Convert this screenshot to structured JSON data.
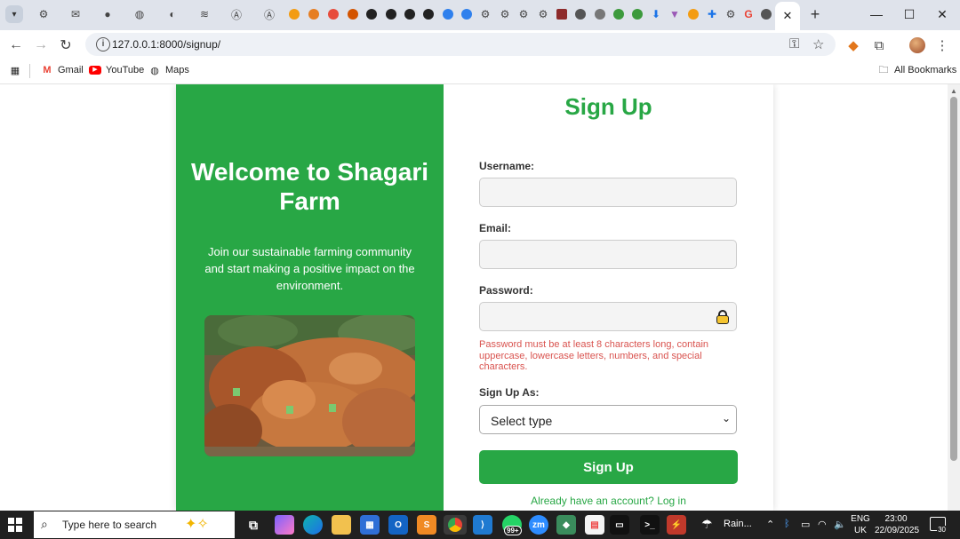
{
  "browser": {
    "url": "127.0.0.1:8000/signup/",
    "bookmarks": [
      {
        "label": "Gmail",
        "icon": "gmail-icon"
      },
      {
        "label": "YouTube",
        "icon": "youtube-icon"
      },
      {
        "label": "Maps",
        "icon": "maps-icon"
      }
    ],
    "all_bookmarks": "All Bookmarks"
  },
  "page": {
    "welcome_title": "Welcome to Shagari Farm",
    "intro_text": "Join our sustainable farming community and start making a positive impact on the environment.",
    "form_title": "Sign Up",
    "username_label": "Username:",
    "email_label": "Email:",
    "password_label": "Password:",
    "password_error": "Password must be at least 8 characters long, contain uppercase, lowercase letters, numbers, and special characters.",
    "signup_as_label": "Sign Up As:",
    "signup_as_selected": "Select type",
    "submit_label": "Sign Up",
    "login_link": "Already have an account? Log in"
  },
  "taskbar": {
    "search_placeholder": "Type here to search",
    "weather": "Rain...",
    "language": [
      "ENG",
      "UK"
    ],
    "time": "23:00",
    "date": "22/09/2025",
    "notifications": "30",
    "whatsapp_badge": "99+"
  },
  "colors": {
    "brand_green": "#28a745",
    "error_red": "#d9534f"
  }
}
